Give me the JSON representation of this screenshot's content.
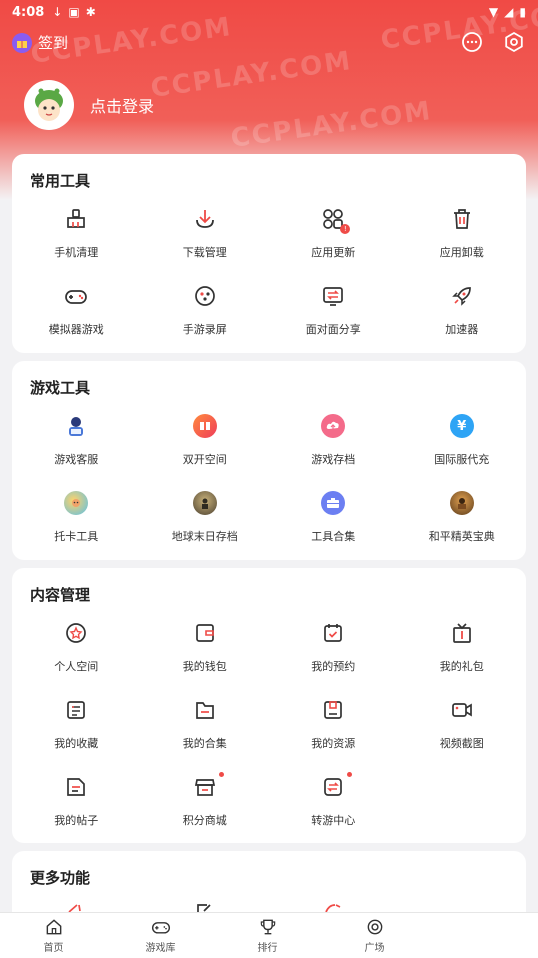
{
  "status_bar": {
    "time": "4:08"
  },
  "header": {
    "signin_label": "签到",
    "login_label": "点击登录",
    "watermark": "CCPLAY.COM"
  },
  "sections": [
    {
      "title": "常用工具",
      "items": [
        {
          "label": "手机清理",
          "icon": "broom-icon"
        },
        {
          "label": "下载管理",
          "icon": "download-icon"
        },
        {
          "label": "应用更新",
          "icon": "app-update-icon"
        },
        {
          "label": "应用卸载",
          "icon": "trash-icon"
        },
        {
          "label": "模拟器游戏",
          "icon": "gamepad-icon"
        },
        {
          "label": "手游录屏",
          "icon": "screen-record-icon"
        },
        {
          "label": "面对面分享",
          "icon": "share-transfer-icon"
        },
        {
          "label": "加速器",
          "icon": "rocket-icon"
        }
      ]
    },
    {
      "title": "游戏工具",
      "items": [
        {
          "label": "游戏客服",
          "icon": "customer-service-icon"
        },
        {
          "label": "双开空间",
          "icon": "dual-space-icon"
        },
        {
          "label": "游戏存档",
          "icon": "cloud-save-icon"
        },
        {
          "label": "国际服代充",
          "icon": "yen-icon"
        },
        {
          "label": "托卡工具",
          "icon": "toca-icon"
        },
        {
          "label": "地球末日存档",
          "icon": "doomsday-icon"
        },
        {
          "label": "工具合集",
          "icon": "toolbox-icon"
        },
        {
          "label": "和平精英宝典",
          "icon": "pubg-icon"
        }
      ]
    },
    {
      "title": "内容管理",
      "items": [
        {
          "label": "个人空间",
          "icon": "star-circle-icon"
        },
        {
          "label": "我的钱包",
          "icon": "wallet-icon"
        },
        {
          "label": "我的预约",
          "icon": "calendar-check-icon"
        },
        {
          "label": "我的礼包",
          "icon": "gift-box-icon"
        },
        {
          "label": "我的收藏",
          "icon": "collection-icon"
        },
        {
          "label": "我的合集",
          "icon": "folder-icon"
        },
        {
          "label": "我的资源",
          "icon": "resource-icon"
        },
        {
          "label": "视频截图",
          "icon": "video-icon"
        },
        {
          "label": "我的帖子",
          "icon": "post-icon"
        },
        {
          "label": "积分商城",
          "icon": "store-icon"
        },
        {
          "label": "转游中心",
          "icon": "swap-icon"
        }
      ]
    },
    {
      "title": "更多功能"
    }
  ],
  "bottom_nav": [
    {
      "label": "首页",
      "icon": "home-icon"
    },
    {
      "label": "游戏库",
      "icon": "game-library-icon"
    },
    {
      "label": "排行",
      "icon": "trophy-icon"
    },
    {
      "label": "广场",
      "icon": "plaza-icon"
    }
  ],
  "colors": {
    "accent": "#ef4b47",
    "header": "#f04a45"
  }
}
